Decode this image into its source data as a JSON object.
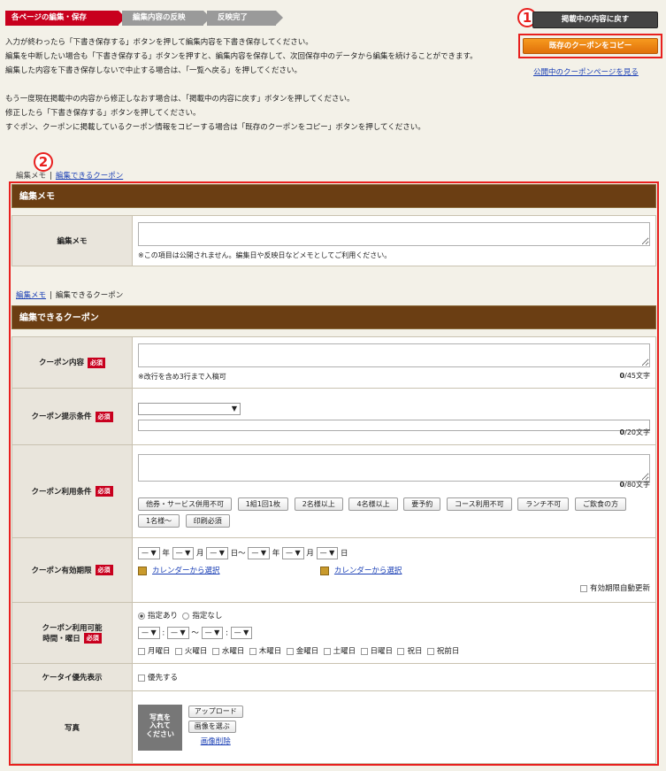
{
  "steps": [
    "各ページの編集・保存",
    "編集内容の反映",
    "反映完了"
  ],
  "intro": [
    "入力が終わったら「下書き保存する」ボタンを押して編集内容を下書き保存してください。",
    "編集を中断したい場合も「下書き保存する」ボタンを押すと、編集内容を保存して、次回保存中のデータから編集を続けることができます。",
    "編集した内容を下書き保存しないで中止する場合は、「一覧へ戻る」を押してください。",
    "もう一度現在掲載中の内容から修正しなおす場合は、「掲載中の内容に戻す」ボタンを押してください。",
    "修正したら「下書き保存する」ボタンを押してください。",
    "すぐポン、クーポンに掲載しているクーポン情報をコピーする場合は「既存のクーポンをコピー」ボタンを押してください。"
  ],
  "actions": {
    "restore_label": "掲載中の内容に戻す",
    "copy_label": "既存のクーポンをコピー",
    "public_link": "公開中のクーポンページを見る"
  },
  "badges": {
    "one": "1",
    "two": "2"
  },
  "tabs": {
    "memo": "編集メモ",
    "coupon": "編集できるクーポン",
    "sep": "|"
  },
  "memo_section": {
    "title": "編集メモ",
    "label": "編集メモ",
    "note": "※この項目は公開されません。編集日や反映日などメモとしてご利用ください。"
  },
  "coupon_section": {
    "title": "編集できるクーポン",
    "required": "必須",
    "content": {
      "label": "クーポン内容",
      "note": "※改行を含め3行まで入稿可",
      "count": "0",
      "max": "/45文字"
    },
    "condition": {
      "label": "クーポン提示条件",
      "count": "0",
      "max": "/20文字"
    },
    "usage": {
      "label": "クーポン利用条件",
      "count": "0",
      "max": "/80文字",
      "chips": [
        "他券・サービス併用不可",
        "1組1回1枚",
        "2名様以上",
        "4名様以上",
        "要予約",
        "コース利用不可",
        "ランチ不可",
        "ご飲食の方",
        "1名様〜",
        "印刷必須"
      ]
    },
    "validity": {
      "label": "クーポン有効期限",
      "dash": "—",
      "year": "年",
      "month": "月",
      "day_from": "日〜",
      "day": "日",
      "calendar_link": "カレンダーから選択",
      "auto_renew": "有効期限自動更新"
    },
    "hours": {
      "label_line1": "クーポン利用可能",
      "label_line2": "時間・曜日",
      "opt_yes": "指定あり",
      "opt_no": "指定なし",
      "colon": ":",
      "tilde": "〜",
      "days": [
        "月曜日",
        "火曜日",
        "水曜日",
        "木曜日",
        "金曜日",
        "土曜日",
        "日曜日",
        "祝日",
        "祝前日"
      ]
    },
    "mobile": {
      "label": "ケータイ優先表示",
      "check": "優先する"
    },
    "photo": {
      "label": "写真",
      "placeholder_line1": "写真を",
      "placeholder_line2": "入れて",
      "placeholder_line3": "ください",
      "upload": "アップロード",
      "choose": "画像を選ぶ",
      "delete": "画像削除"
    }
  }
}
